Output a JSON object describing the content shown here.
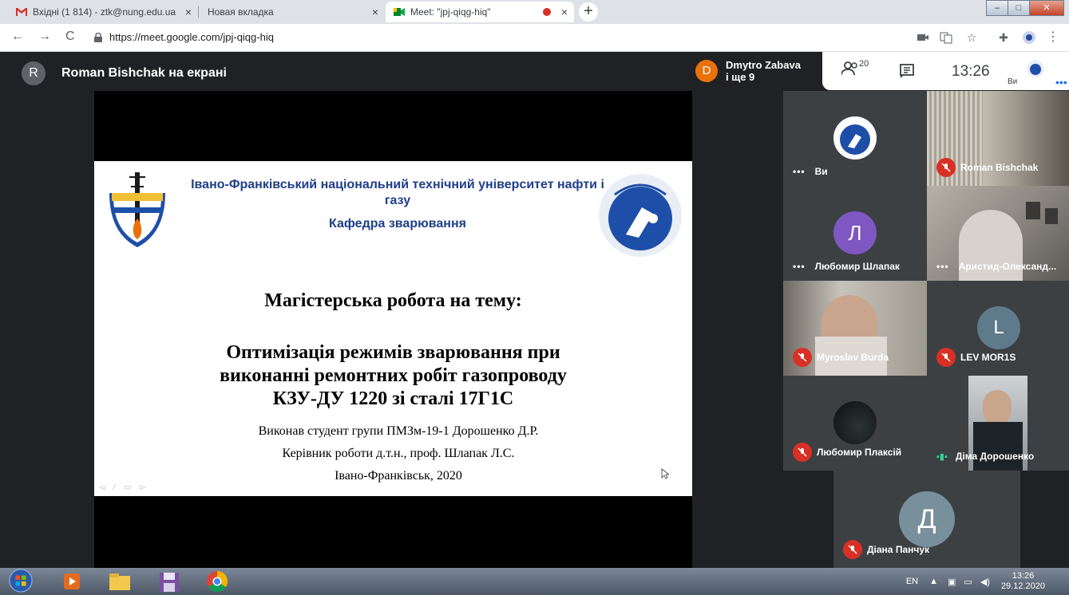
{
  "browser": {
    "tabs": [
      {
        "label": "Вхідні (1 814) - ztk@nung.edu.ua",
        "close": "×"
      },
      {
        "label": "Новая вкладка",
        "close": "×"
      },
      {
        "label": "Meet: \"jpj-qiqg-hiq\"",
        "close": "×"
      }
    ],
    "new_tab": "+",
    "url": "https://meet.google.com/jpj-qiqg-hiq"
  },
  "meet": {
    "presenter_initial": "R",
    "presenter_label": "Roman Bishchak на екрані",
    "participant_initial": "D",
    "participant_name": "Dmytro Zabava",
    "participant_more": "і ще 9",
    "people_count": "20",
    "time": "13:26",
    "self_label": "Ви",
    "more_dots": "•••"
  },
  "slide": {
    "university": "Івано-Франківський національний технічний університет нафти і газу",
    "department": "Кафедра зварювання",
    "heading": "Магістерська робота на тему:",
    "topic_line1": "Оптимізація режимів зварювання при",
    "topic_line2": "виконанні ремонтних робіт газопроводу",
    "topic_line3": "КЗУ-ДУ 1220 зі сталі 17Г1С",
    "author": "Виконав студент групи ПМЗм-19-1 Дорошенко Д.Р.",
    "supervisor": "Керівник роботи д.т.н., проф. Шлапак Л.С.",
    "city_year": "Івано-Франківськ, 2020"
  },
  "tiles": [
    {
      "name": "Ви",
      "state": "dots"
    },
    {
      "name": "Roman Bishchak",
      "state": "muted"
    },
    {
      "name": "Любомир Шлапак",
      "initial": "Л",
      "state": "dots"
    },
    {
      "name": "Аристид-Олександ...",
      "state": "dots"
    },
    {
      "name": "Myroslav Burda",
      "state": "muted"
    },
    {
      "name": "LEV MOR1S",
      "initial": "L",
      "state": "muted"
    },
    {
      "name": "Любомир Плаксій",
      "state": "muted"
    },
    {
      "name": "Діма Дорошенко",
      "state": "speaking"
    },
    {
      "name": "Діана Панчук",
      "initial": "Д",
      "state": "muted"
    }
  ],
  "taskbar": {
    "lang": "EN",
    "time": "13:26",
    "date": "29.12.2020"
  },
  "colors": {
    "meet_bg": "#202124",
    "tile_bg": "#3c4043",
    "mic_off": "#d93025",
    "accent_purple": "#7e57c2",
    "accent_grey": "#5f6368"
  }
}
